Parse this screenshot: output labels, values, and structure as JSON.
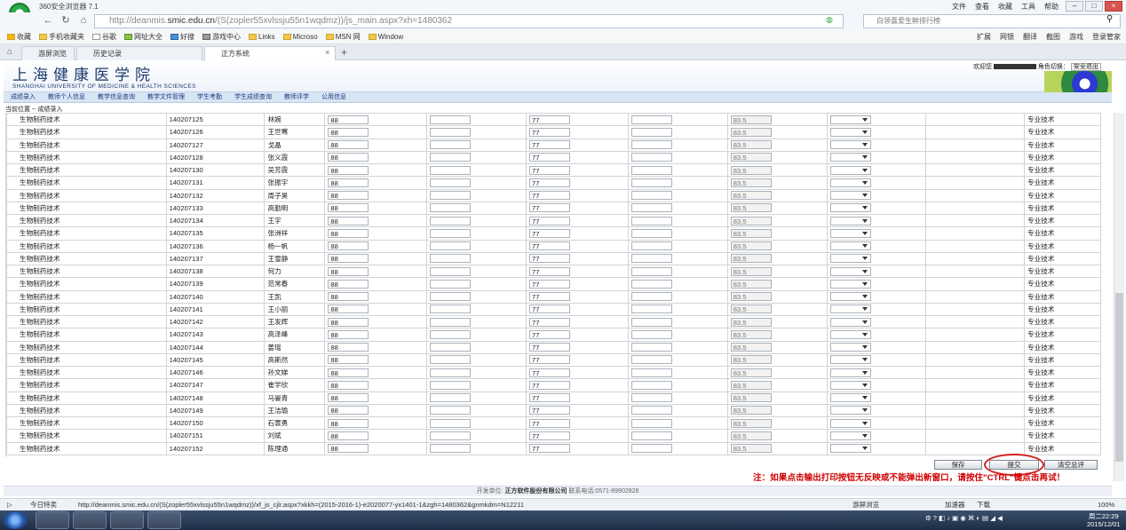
{
  "browser": {
    "app_title": "360安全浏览器 7.1",
    "menu": [
      "文件",
      "查看",
      "收藏",
      "工具",
      "帮助"
    ],
    "url_prefix": "http://deanmis.",
    "url_host": "smic.edu.cn",
    "url_path": "/(S(zopler55xvlssju55n1wqdmz))/js_main.aspx?xh=1480362",
    "search_placeholder": "白领喜爱生鲜排行榜",
    "favorites": [
      "收藏",
      "手机收藏夹",
      "谷歌",
      "网址大全",
      "好搜",
      "游戏中心",
      "Links",
      "Microso",
      "MSN 网",
      "Window"
    ],
    "toolbar_right": [
      "扩展",
      "网银",
      "翻译",
      "截图",
      "游戏",
      "登录管家"
    ],
    "tabs": [
      "游屏浏览",
      "历史记录",
      "正方系统"
    ],
    "new_tab": "+"
  },
  "page": {
    "school_cn": "上海健康医学院",
    "school_en": "SHANGHAI UNIVERSITY OF MEDICINE & HEALTH SCIENCES",
    "welcome": "欢迎您",
    "role_switch": "角色切换：",
    "logout": "安全退出",
    "menu": [
      "成绩录入",
      "教师个人信息",
      "教学信息查询",
      "教学文件管理",
      "学生考勤",
      "学生成绩查询",
      "教师评学",
      "公用信息"
    ],
    "breadcrumb": "当前位置 -- 成绩录入"
  },
  "table": {
    "major": "生物制药技术",
    "score1": "88",
    "score2": "77",
    "total": "83.5",
    "category": "专业技术",
    "rows": [
      {
        "id": "140207125",
        "name": "林婉"
      },
      {
        "id": "140207126",
        "name": "王世骞"
      },
      {
        "id": "140207127",
        "name": "戈晶"
      },
      {
        "id": "140207128",
        "name": "张义霞"
      },
      {
        "id": "140207130",
        "name": "吴芳霞"
      },
      {
        "id": "140207131",
        "name": "张振宇"
      },
      {
        "id": "140207132",
        "name": "周子昊"
      },
      {
        "id": "140207133",
        "name": "高勤明"
      },
      {
        "id": "140207134",
        "name": "王宇"
      },
      {
        "id": "140207135",
        "name": "张洲祥"
      },
      {
        "id": "140207136",
        "name": "杨一帆"
      },
      {
        "id": "140207137",
        "name": "王雪静"
      },
      {
        "id": "140207138",
        "name": "何力"
      },
      {
        "id": "140207139",
        "name": "范常春"
      },
      {
        "id": "140207140",
        "name": "王凯"
      },
      {
        "id": "140207141",
        "name": "王小丽"
      },
      {
        "id": "140207142",
        "name": "王发辉"
      },
      {
        "id": "140207143",
        "name": "高泽峰"
      },
      {
        "id": "140207144",
        "name": "姜瑶"
      },
      {
        "id": "140207145",
        "name": "高斯然"
      },
      {
        "id": "140207146",
        "name": "孙文娣"
      },
      {
        "id": "140207147",
        "name": "崔学欣"
      },
      {
        "id": "140207148",
        "name": "马晏青"
      },
      {
        "id": "140207149",
        "name": "王洁瑜"
      },
      {
        "id": "140207150",
        "name": "石寰勇"
      },
      {
        "id": "140207151",
        "name": "刘斌"
      },
      {
        "id": "140207152",
        "name": "陈理通"
      }
    ]
  },
  "actions": {
    "save": "保存",
    "submit": "提交",
    "clear": "清空总评",
    "note": "注：如果点击输出打印按钮无反映或不能弹出新窗口，请按住\"CTRL\"键点击再试！"
  },
  "footer": {
    "dev_label": "开发单位:",
    "company": "正方软件股份有限公司",
    "phone": "联系电话:0571-89902828"
  },
  "statusbar": {
    "today": "今日特卖",
    "url": "http://deanmis.smic.edu.cn/(S(zopler55xvlssju55n1wqdmz))/xf_js_cjlr.aspx?xkkh=(2015-2016-1)-e2020077-yx1401-1&zgh=1480362&gnmkdm=N12211",
    "items": [
      "游屏浏览",
      "加速器",
      "下载"
    ],
    "zoom": "100%"
  },
  "taskbar": {
    "time": "周二22:29",
    "date": "2015/12/01"
  }
}
